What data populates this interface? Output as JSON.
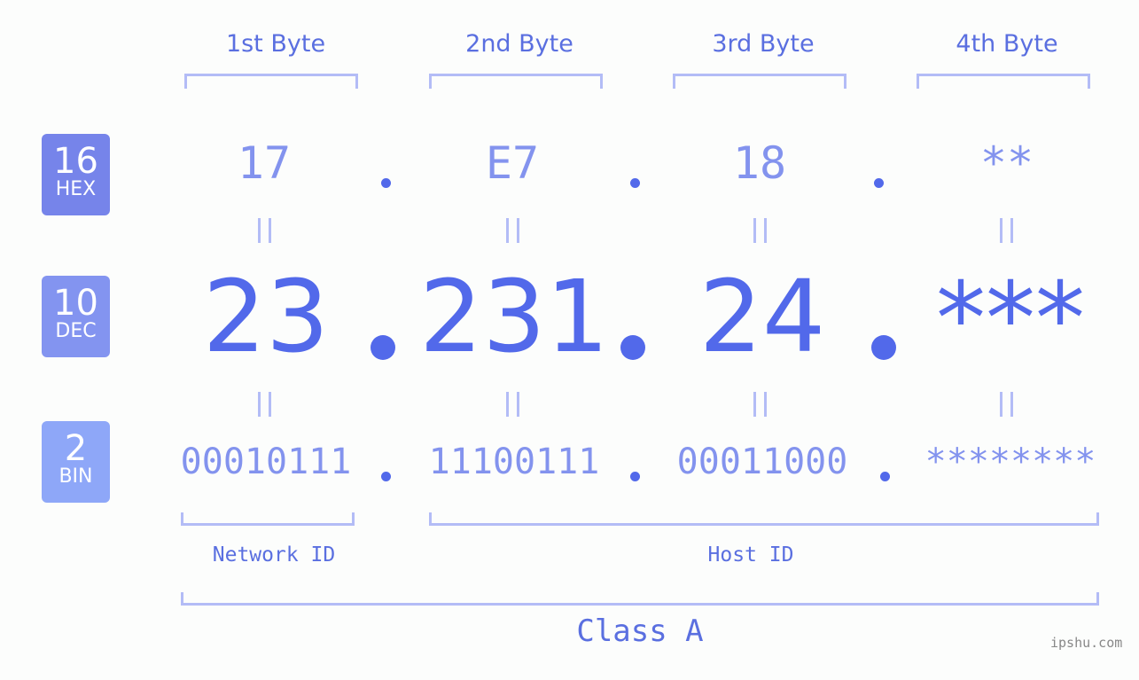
{
  "bytes": [
    {
      "header": "1st Byte",
      "hex": "17",
      "dec": "23",
      "bin": "00010111"
    },
    {
      "header": "2nd Byte",
      "hex": "E7",
      "dec": "231",
      "bin": "11100111"
    },
    {
      "header": "3rd Byte",
      "hex": "18",
      "dec": "24",
      "bin": "00011000"
    },
    {
      "header": "4th Byte",
      "hex": "**",
      "dec": "***",
      "bin": "********"
    }
  ],
  "badges": {
    "hex": {
      "num": "16",
      "label": "HEX",
      "color": "#7684ea"
    },
    "dec": {
      "num": "10",
      "label": "DEC",
      "color": "#8394f0"
    },
    "bin": {
      "num": "2",
      "label": "BIN",
      "color": "#8ea7f8"
    }
  },
  "equals": "=",
  "labels": {
    "network_id": "Network ID",
    "host_id": "Host ID",
    "class": "Class A"
  },
  "watermark": "ipshu.com",
  "colors": {
    "accent": "#5269ea",
    "light": "#8393ee",
    "bracket": "#b3bcf6"
  }
}
